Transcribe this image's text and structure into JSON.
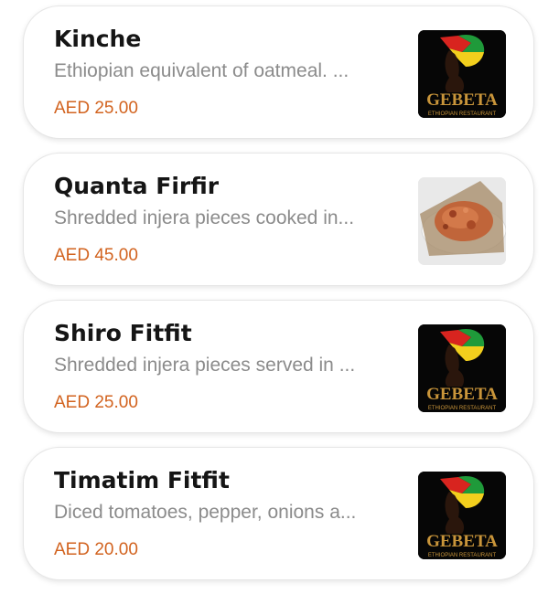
{
  "items": [
    {
      "name": "Kinche",
      "description": "Ethiopian equivalent of oatmeal. ...",
      "price": "AED 25.00",
      "image": "gebeta-logo",
      "logo_text": "GEBETA",
      "logo_subtext": "ETHIOPIAN RESTAURANT"
    },
    {
      "name": "Quanta Firfir",
      "description": "Shredded injera pieces cooked in...",
      "price": "AED 45.00",
      "image": "food-photo"
    },
    {
      "name": "Shiro Fitfit",
      "description": "Shredded injera pieces served in ...",
      "price": "AED 25.00",
      "image": "gebeta-logo",
      "logo_text": "GEBETA",
      "logo_subtext": "ETHIOPIAN RESTAURANT"
    },
    {
      "name": "Timatim Fitfit",
      "description": "Diced tomatoes, pepper, onions a...",
      "price": "AED 20.00",
      "image": "gebeta-logo",
      "logo_text": "GEBETA",
      "logo_subtext": "ETHIOPIAN RESTAURANT"
    }
  ],
  "colors": {
    "price": "#d2631f",
    "name": "#151515",
    "description": "#8b8b8b",
    "logo_background": "#060606",
    "logo_text": "#c9953a"
  }
}
